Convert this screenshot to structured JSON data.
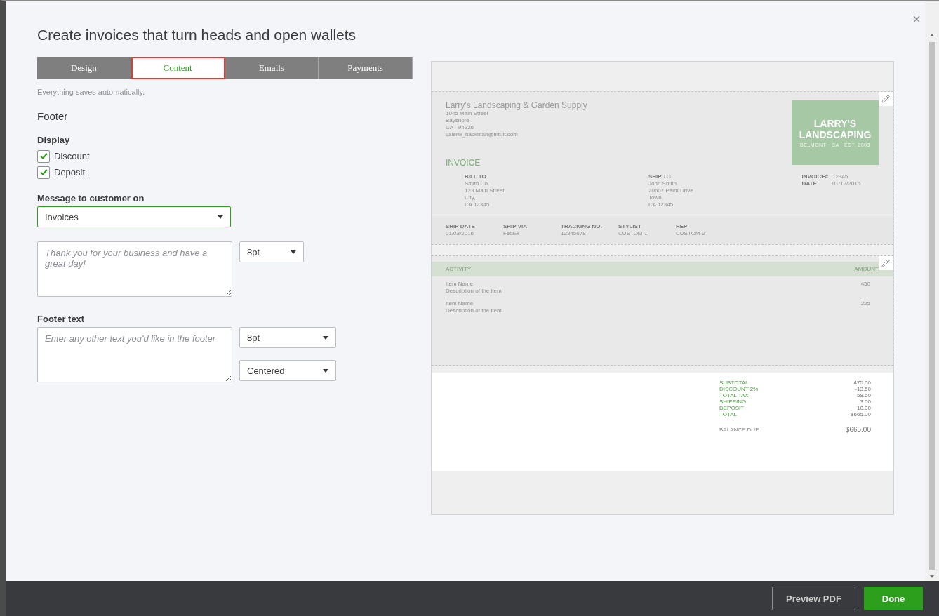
{
  "dialog": {
    "title": "Create invoices that turn heads and open wallets",
    "close": "×"
  },
  "tabs": [
    {
      "label": "Design",
      "selected": false
    },
    {
      "label": "Content",
      "selected": true
    },
    {
      "label": "Emails",
      "selected": false
    },
    {
      "label": "Payments",
      "selected": false
    }
  ],
  "note": "Everything saves automatically.",
  "section_title": "Footer",
  "display": {
    "label": "Display",
    "options": [
      {
        "label": "Discount",
        "checked": true
      },
      {
        "label": "Deposit",
        "checked": true
      }
    ]
  },
  "message": {
    "label": "Message to customer on",
    "dropdown": "Invoices",
    "placeholder": "Thank you for your business and have a great day!",
    "font_size": "8pt"
  },
  "footer_text": {
    "label": "Footer text",
    "placeholder": "Enter any other text you'd like in the footer",
    "font_size": "8pt",
    "alignment": "Centered"
  },
  "preview": {
    "company": "Larry's Landscaping & Garden Supply",
    "address": [
      "1045 Main Street",
      "Bayshore",
      "CA - 94326",
      "valerie_hackman@intuit.com"
    ],
    "logo": {
      "line1": "LARRY'S",
      "line2": "LANDSCAPING",
      "tagline": "BELMONT · CA · EST. 2003"
    },
    "heading": "INVOICE",
    "bill_to": {
      "label": "BILL TO",
      "lines": [
        "Smith Co.",
        "123 Main Street",
        "City,",
        "CA 12345"
      ]
    },
    "ship_to": {
      "label": "SHIP TO",
      "lines": [
        "John Smith",
        "20607 Palm Drive",
        "Town,",
        "CA 12345"
      ]
    },
    "meta": [
      {
        "label": "INVOICE#",
        "value": "12345"
      },
      {
        "label": "DATE",
        "value": "01/12/2016"
      }
    ],
    "ship_fields": [
      {
        "label": "SHIP DATE",
        "value": "01/03/2016"
      },
      {
        "label": "SHIP VIA",
        "value": "FedEx"
      },
      {
        "label": "TRACKING NO.",
        "value": "12345678"
      },
      {
        "label": "STYLIST",
        "value": "CUSTOM-1"
      },
      {
        "label": "REP",
        "value": "CUSTOM-2"
      }
    ],
    "columns": [
      "ACTIVITY",
      "AMOUNT"
    ],
    "items": [
      {
        "name": "Item Name",
        "description": "Description of the item",
        "amount": "450"
      },
      {
        "name": "Item Name",
        "description": "Description of the item",
        "amount": "225"
      }
    ],
    "totals": [
      {
        "label": "SUBTOTAL",
        "value": "475.00"
      },
      {
        "label": "DISCOUNT 2%",
        "value": "-13.50"
      },
      {
        "label": "TOTAL TAX",
        "value": "58.50"
      },
      {
        "label": "SHIPPING",
        "value": "3.50"
      },
      {
        "label": "DEPOSIT",
        "value": "10.00"
      },
      {
        "label": "TOTAL",
        "value": "$665.00"
      }
    ],
    "balance": {
      "label": "BALANCE DUE",
      "value": "$665.00"
    }
  },
  "buttons": [
    {
      "label": "Preview PDF",
      "kind": "secondary"
    },
    {
      "label": "Done",
      "kind": "primary"
    }
  ]
}
